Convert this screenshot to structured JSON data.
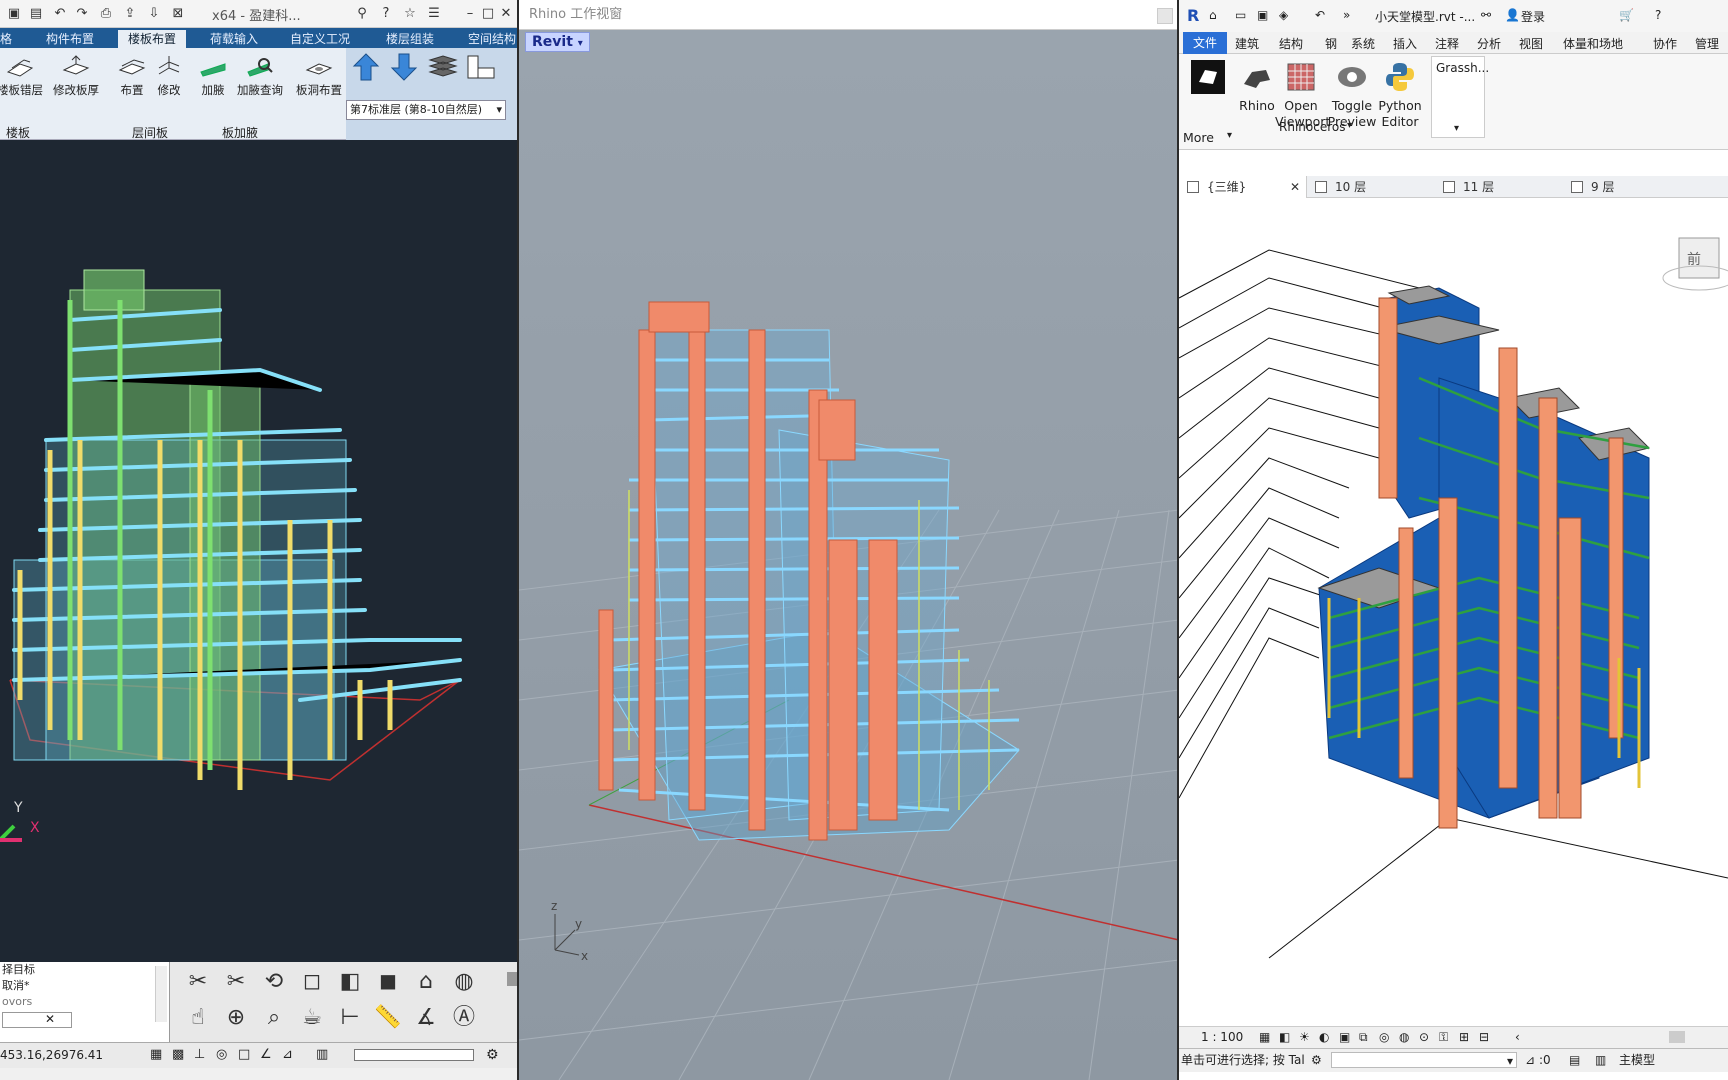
{
  "left": {
    "title": "x64 - 盈建科...",
    "tabs": [
      "格",
      "构件布置",
      "楼板布置",
      "荷载输入",
      "自定义工况",
      "楼层组装",
      "空间结构"
    ],
    "active_tab": 2,
    "buttons": [
      "楼板错层",
      "修改板厚",
      "布置",
      "修改",
      "加腋",
      "加腋查询",
      "板洞布置"
    ],
    "groups": [
      "楼板",
      "层间板",
      "板加腋"
    ],
    "floor_select": "第7标准层 (第8-10自然层)",
    "cmd_lines": [
      "择目标",
      "取消*",
      "ovors"
    ],
    "axis_y": "Y",
    "axis_x": "X",
    "coords": "453.16,26976.41"
  },
  "mid": {
    "title": "Rhino 工作视窗",
    "revit_label": "Revit",
    "axis_z": "z",
    "axis_y": "y",
    "axis_x": "x"
  },
  "right": {
    "file_title": "小天堂模型.rvt -...",
    "login": "登录",
    "tabs": [
      "文件",
      "建筑",
      "结构",
      "钢",
      "系统",
      "插入",
      "注释",
      "分析",
      "视图",
      "体量和场地",
      "协作",
      "管理"
    ],
    "ribbon_buttons": [
      "Rhino",
      "Open Viewport",
      "Toggle Preview",
      "Python Editor"
    ],
    "more_label": "More",
    "panel_label": "Rhinoceros",
    "grass_label": "Grassh...",
    "view_tabs": [
      "{三维}",
      "10 层",
      "11 层",
      "9 层"
    ],
    "scale": "1 : 100",
    "status_text": "单击可进行选择; 按 Tal",
    "zero": ":0",
    "main_model": "主模型",
    "cube_label": "前"
  }
}
